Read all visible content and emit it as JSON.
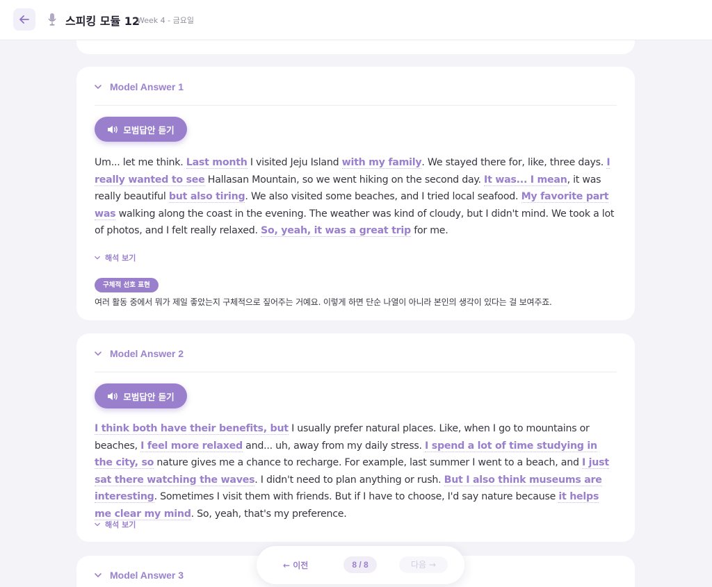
{
  "header": {
    "title": "스피킹 모듈 12",
    "subtitle": "Week 4 - 금요일"
  },
  "answers": [
    {
      "heading": "Model Answer 1",
      "listen_label": "모범답안 듣기",
      "segments": [
        {
          "t": "Um... let me think. ",
          "h": false
        },
        {
          "t": "Last month",
          "h": true
        },
        {
          "t": " I visited Jeju Island ",
          "h": false
        },
        {
          "t": "with my family",
          "h": true
        },
        {
          "t": ". We stayed there for, like, three days. ",
          "h": false
        },
        {
          "t": "I really wanted to see",
          "h": true
        },
        {
          "t": " Hallasan Mountain, so we went hiking on the second day. ",
          "h": false
        },
        {
          "t": "It was... I mean",
          "h": true
        },
        {
          "t": ", it was really beautiful ",
          "h": false
        },
        {
          "t": "but also tiring",
          "h": true
        },
        {
          "t": ". We also visited some beaches, and I tried local seafood. ",
          "h": false
        },
        {
          "t": "My favorite part was",
          "h": true
        },
        {
          "t": " walking along the coast in the evening. The weather was kind of cloudy, but I didn't mind. We took a lot of photos, and I felt really relaxed. ",
          "h": false
        },
        {
          "t": "So, yeah, it was a great trip",
          "h": true
        },
        {
          "t": " for me.",
          "h": false
        }
      ],
      "translate_label": "해석 보기",
      "tip_badge": "구체적 선호 표현",
      "tip_text": "여러 활동 중에서 뭐가 제일 좋았는지 구체적으로 짚어주는 거예요. 이렇게 하면 단순 나열이 아니라 본인의 생각이 있다는 걸 보여주죠."
    },
    {
      "heading": "Model Answer 2",
      "listen_label": "모범답안 듣기",
      "segments": [
        {
          "t": "I think both have their benefits, but",
          "h": true
        },
        {
          "t": " I usually prefer natural places. Like, when I go to mountains or beaches, ",
          "h": false
        },
        {
          "t": "I feel more relaxed",
          "h": true
        },
        {
          "t": " and... uh, away from my daily stress. ",
          "h": false
        },
        {
          "t": "I spend a lot of time studying in the city, so",
          "h": true
        },
        {
          "t": " nature gives me a chance to recharge. For example, last summer I went to a beach, and ",
          "h": false
        },
        {
          "t": "I just sat there watching the waves",
          "h": true
        },
        {
          "t": ". I didn't need to plan anything or rush. ",
          "h": false
        },
        {
          "t": "But I also think museums are interesting",
          "h": true
        },
        {
          "t": ". Sometimes I visit them with friends. But if I have to choose, I'd say nature because ",
          "h": false
        },
        {
          "t": "it helps me clear my mind",
          "h": true
        },
        {
          "t": ". So, yeah, that's my preference.",
          "h": false
        }
      ],
      "translate_label": "해석 보기"
    },
    {
      "heading": "Model Answer 3"
    }
  ],
  "pager": {
    "prev_label": "← 이전",
    "count": "8 / 8",
    "next_label": "다음 →"
  },
  "colors": {
    "accent": "#9a80cc",
    "background": "#f4f3f8"
  },
  "icons": {
    "back": "arrow-left-icon",
    "mic": "microphone-icon",
    "speaker": "speaker-icon",
    "chevron": "chevron-down-icon"
  }
}
